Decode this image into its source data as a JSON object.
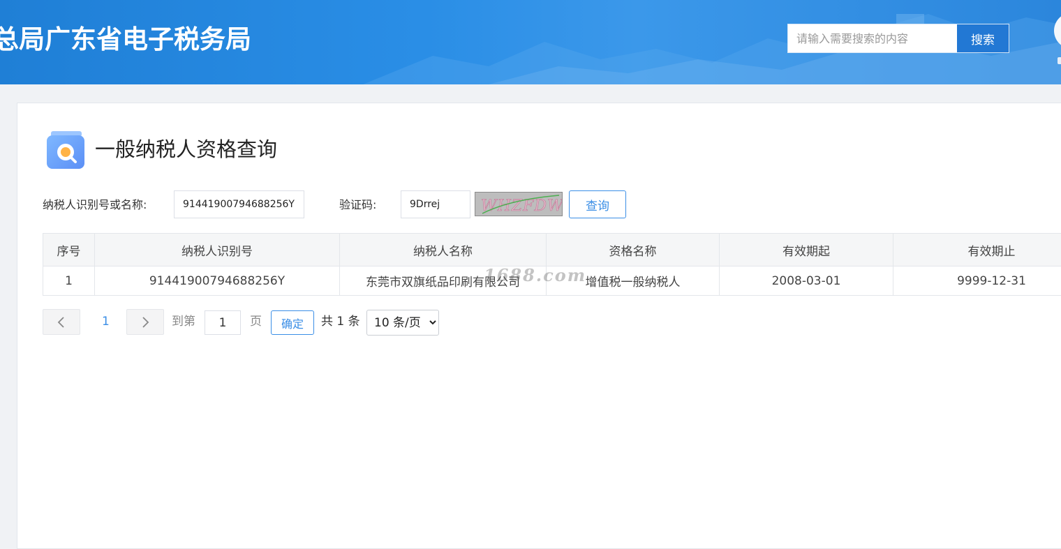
{
  "header": {
    "site_title": "总局广东省电子税务局",
    "search_placeholder": "请输入需要搜索的内容",
    "search_button": "搜索"
  },
  "page": {
    "title": "一般纳税人资格查询"
  },
  "form": {
    "taxpayer_label": "纳税人识别号或名称:",
    "taxpayer_value": "91441900794688256Y",
    "captcha_label": "验证码:",
    "captcha_value": "9Drrej",
    "captcha_image_text": "WHZFDW",
    "query_button": "查询"
  },
  "table": {
    "columns": [
      "序号",
      "纳税人识别号",
      "纳税人名称",
      "资格名称",
      "有效期起",
      "有效期止"
    ],
    "rows": [
      [
        "1",
        "91441900794688256Y",
        "东莞市双旗纸品印刷有限公司",
        "增值税一般纳税人",
        "2008-03-01",
        "9999-12-31"
      ]
    ]
  },
  "watermark": "1688.com",
  "pagination": {
    "current_page": "1",
    "goto_label": "到第",
    "page_input_value": "1",
    "page_unit": "页",
    "confirm_button": "确定",
    "total": "共 1 条",
    "page_size": "10 条/页"
  },
  "colors": {
    "header_blue": "#2a8ee6",
    "search_button": "#2278d4",
    "accent": "#3a8ee6"
  }
}
